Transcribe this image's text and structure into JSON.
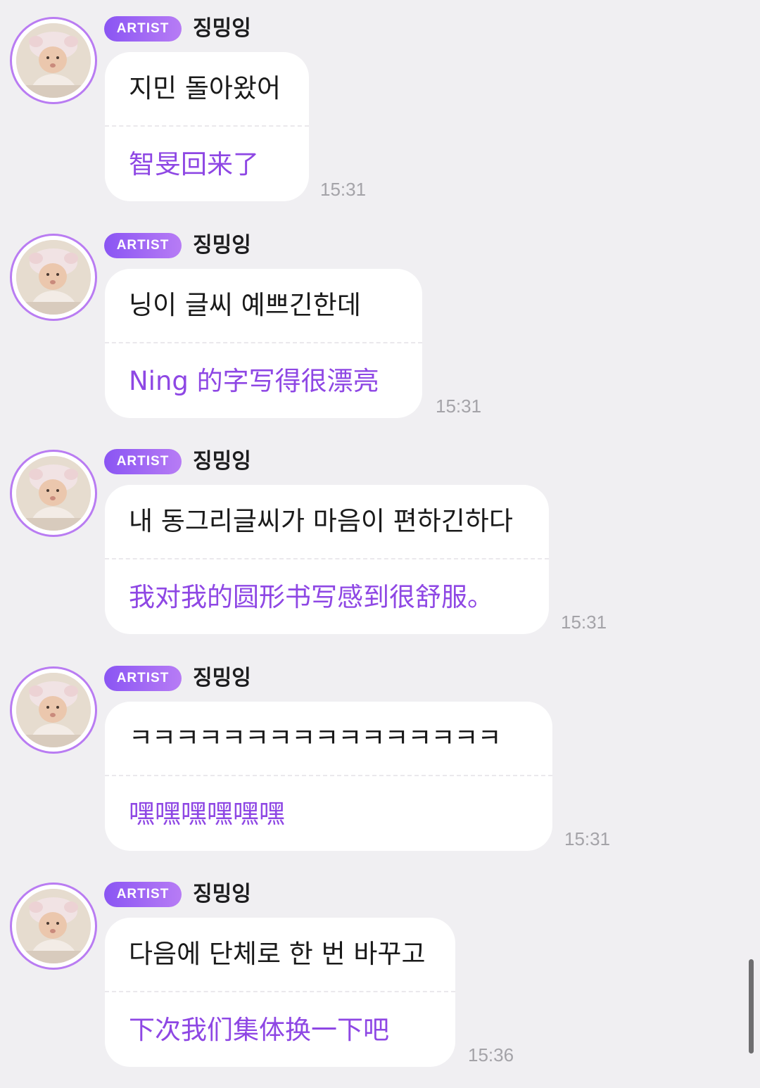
{
  "colors": {
    "background": "#f0eff2",
    "bubble": "#ffffff",
    "accent_purple": "#8e47e4",
    "badge_gradient_start": "#8a55f3",
    "badge_gradient_end": "#b77cf5",
    "timestamp": "#a4a3a8"
  },
  "messages": [
    {
      "badge": "ARTIST",
      "sender": "징밍잉",
      "text": "지민 돌아왔어",
      "translation": "智旻回来了",
      "time": "15:31"
    },
    {
      "badge": "ARTIST",
      "sender": "징밍잉",
      "text": "닝이 글씨 예쁘긴한데",
      "translation": "Ning 的字写得很漂亮",
      "time": "15:31"
    },
    {
      "badge": "ARTIST",
      "sender": "징밍잉",
      "text": "내 동그리글씨가 마음이 편하긴하다",
      "translation": "我对我的圆形书写感到很舒服。",
      "time": "15:31"
    },
    {
      "badge": "ARTIST",
      "sender": "징밍잉",
      "text": "ㅋㅋㅋㅋㅋㅋㅋㅋㅋㅋㅋㅋㅋㅋㅋㅋ",
      "translation": "嘿嘿嘿嘿嘿嘿",
      "time": "15:31"
    },
    {
      "badge": "ARTIST",
      "sender": "징밍잉",
      "text": "다음에 단체로 한 번 바꾸고",
      "translation": "下次我们集体换一下吧",
      "time": "15:36"
    }
  ]
}
